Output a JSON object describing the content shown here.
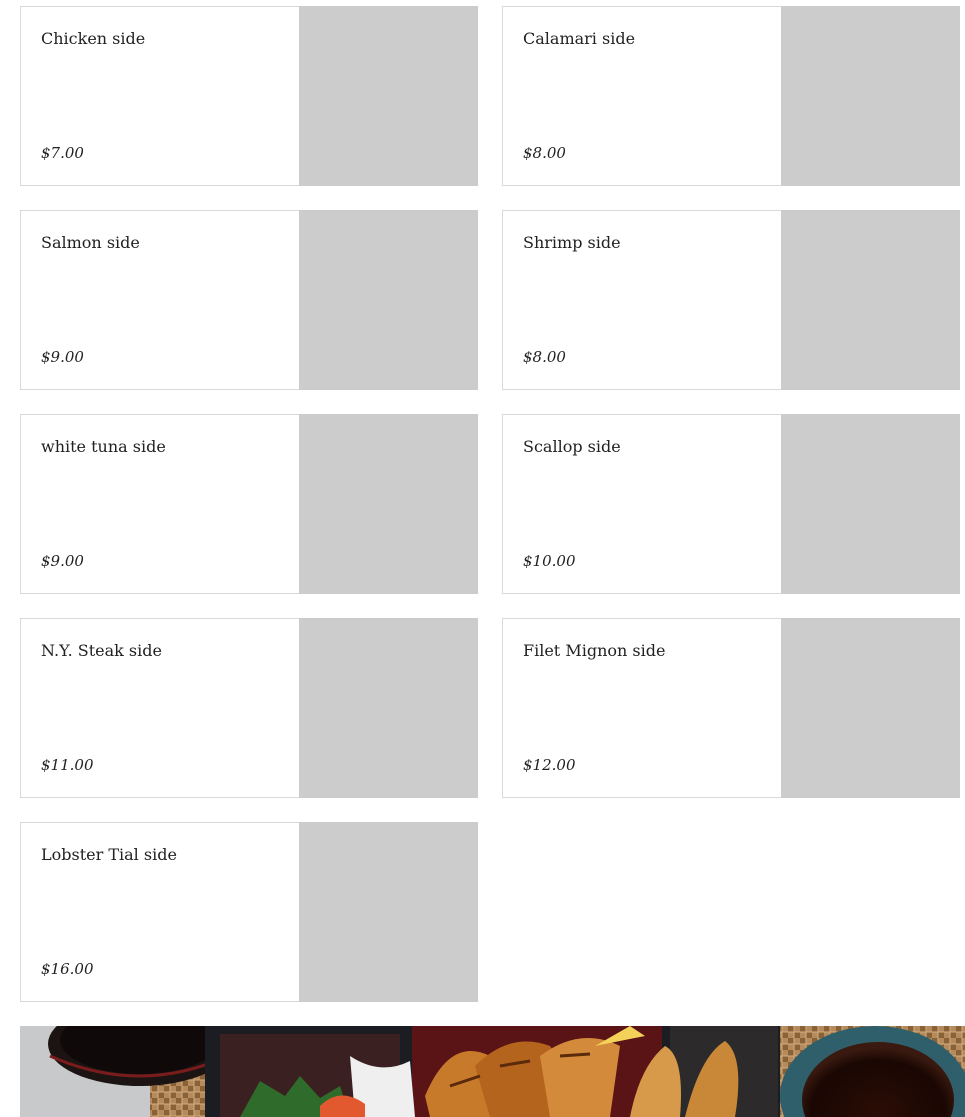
{
  "menu": {
    "items": [
      {
        "name": "Chicken side",
        "price": "$7.00"
      },
      {
        "name": "Calamari side",
        "price": "$8.00"
      },
      {
        "name": "Salmon side",
        "price": "$9.00"
      },
      {
        "name": "Shrimp side",
        "price": "$8.00"
      },
      {
        "name": "white tuna side",
        "price": "$9.00"
      },
      {
        "name": "Scallop side",
        "price": "$10.00"
      },
      {
        "name": "N.Y. Steak side",
        "price": "$11.00"
      },
      {
        "name": "Filet Mignon side",
        "price": "$12.00"
      },
      {
        "name": "Lobster Tial side",
        "price": "$16.00"
      }
    ]
  },
  "colors": {
    "image_placeholder": "#cccccc",
    "card_border": "#d9d9d9",
    "text": "#222222"
  }
}
